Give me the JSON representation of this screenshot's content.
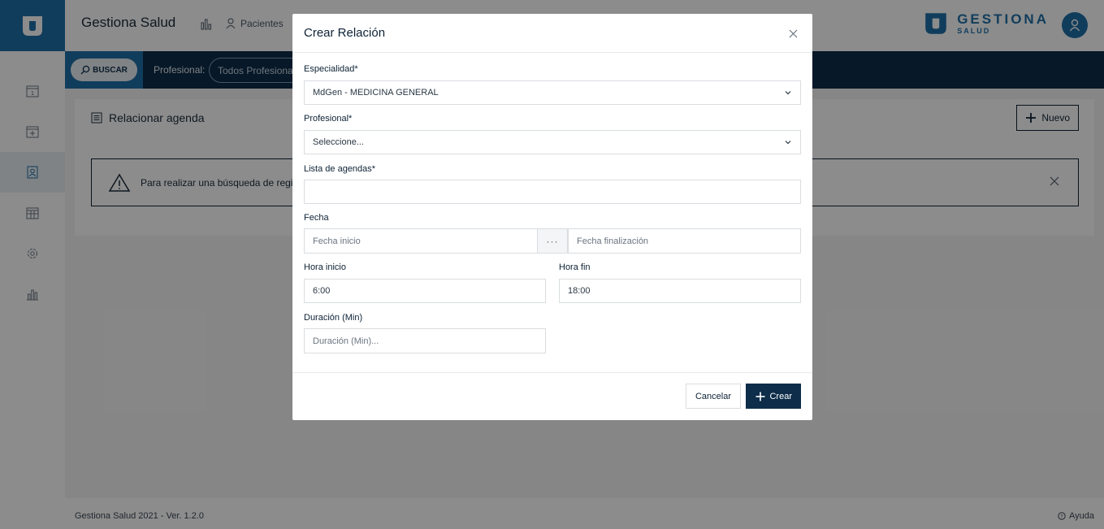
{
  "app": {
    "title": "Gestiona Salud",
    "brand_name": "GESTIONA",
    "brand_sub": "SALUD",
    "nav_pacientes": "Pacientes"
  },
  "filterbar": {
    "buscar_label": "BUSCAR",
    "profesional_label": "Profesional:",
    "profesional_value": "Todos Profesional..."
  },
  "card": {
    "title": "Relacionar agenda",
    "nuevo_label": "Nuevo",
    "alert_text": "Para realizar una búsqueda de regist"
  },
  "footer": {
    "version": "Gestiona Salud 2021 - Ver. 1.2.0",
    "help": "Ayuda"
  },
  "modal": {
    "title": "Crear Relación",
    "especialidad_label": "Especialidad*",
    "especialidad_value": "MdGen - MEDICINA GENERAL",
    "profesional_label": "Profesional*",
    "profesional_placeholder": "Seleccione...",
    "lista_label": "Lista de agendas*",
    "lista_value": "",
    "fecha_label": "Fecha",
    "fecha_inicio_placeholder": "Fecha inicio",
    "fecha_sep": "···",
    "fecha_fin_placeholder": "Fecha finalización",
    "hora_inicio_label": "Hora inicio",
    "hora_inicio_value": "6:00",
    "hora_fin_label": "Hora fin",
    "hora_fin_value": "18:00",
    "duracion_label": "Duración (Min)",
    "duracion_placeholder": "Duración (Min)...",
    "cancel_label": "Cancelar",
    "create_label": "Crear"
  },
  "colors": {
    "primary": "#1f6fa8",
    "dark": "#0d2d4a"
  }
}
